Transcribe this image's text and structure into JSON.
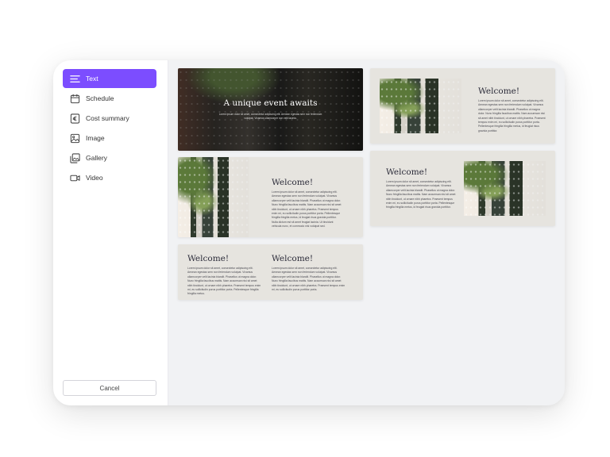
{
  "sidebar": {
    "items": [
      {
        "label": "Text",
        "icon": "text-lines-icon",
        "active": true
      },
      {
        "label": "Schedule",
        "icon": "calendar-icon",
        "active": false
      },
      {
        "label": "Cost summary",
        "icon": "euro-icon",
        "active": false
      },
      {
        "label": "Image",
        "icon": "image-icon",
        "active": false
      },
      {
        "label": "Gallery",
        "icon": "gallery-icon",
        "active": false
      },
      {
        "label": "Video",
        "icon": "video-icon",
        "active": false
      }
    ],
    "cancel_label": "Cancel"
  },
  "templates": {
    "hero": {
      "title": "A unique event awaits",
      "body": "Lorem ipsum dolor sit amet, consectetur adipiscing elit. Aenean egestas sem non feriendum volutpat. Vivamus ullamcorper non velit lacinia."
    },
    "image_left": {
      "title": "Welcome!",
      "body": "Lorem ipsum dolor sit amet, consectetur adipiscing elit. Aenean egestas sem non feriendum volutpat. Vivamus ullamcorper velit lacinia blandit. Phasellus ut magna dolor. Nunc fringilla faucibus mattis. Nam accumsan nisi sit amet nibh tincidunt, ut ornare nibh pharetra. Praesent tempus enim mi, eu sollicitudin purus porttitor porta. Pellentesque fringilla fringilla metus, id feugiat risus gravida porttitor. Nulla dictum est sit amet feugiat lacinia. Ut tincidunt vehicula nunc, et commodo nisi volutpat sed."
    },
    "two_columns": {
      "left_title": "Welcome!",
      "left_body": "Lorem ipsum dolor sit amet, consectetur adipiscing elit. Aenean egestas sem non feriendum volutpat. Vivamus ullamcorper velit lacinia blandit. Phasellus ut magna dolor. Nunc fringilla faucibus mattis. Nam accumsan nisi sit amet nibh tincidunt, ut ornare nibh pharetra. Praesent tempus enim mi, eu sollicitudin purus porttitor porta. Pellentesque fringilla fringilla metus.",
      "right_title": "Welcome!",
      "right_body": "Lorem ipsum dolor sit amet, consectetur adipiscing elit. Aenean egestas sem non feriendum volutpat. Vivamus ullamcorper velit lacinia blandit. Phasellus ut magna dolor. Nunc fringilla faucibus mattis. Nam accumsan nisi sit amet nibh tincidunt, ut ornare nibh pharetra. Praesent tempus enim mi, eu sollicitudin purus porttitor porta."
    },
    "image_right_top": {
      "title": "Welcome!",
      "body": "Lorem ipsum dolor sit amet, consectetur adipiscing elit. Aenean egestas sem non feriendum volutpat. Vivamus ullamcorper velit lacinia blandit. Phasellus ut magna dolor. Nunc fringilla faucibus mattis. Nam accumsan nisi sit amet nibh tincidunt, ut ornare nibh pharetra. Praesent tempus enim mi, eu sollicitudin purus porttitor porta. Pellentesque fringilla fringilla metus, id feugiat risus gravida porttitor."
    },
    "image_right_bottom": {
      "title": "Welcome!",
      "body": "Lorem ipsum dolor sit amet, consectetur adipiscing elit. Aenean egestas sem non feriendum volutpat. Vivamus ullamcorper velit lacinia blandit. Phasellus ut magna dolor. Nunc fringilla faucibus mattis. Nam accumsan nisi sit amet nibh tincidunt, ut ornare nibh pharetra. Praesent tempus enim mi, eu sollicitudin purus porttitor porta. Pellentesque fringilla fringilla metus, id feugiat risus gravida porttitor."
    }
  },
  "colors": {
    "accent": "#7c4dff",
    "card_bg": "#e6e4df",
    "panel_bg": "#f1f2f4"
  }
}
